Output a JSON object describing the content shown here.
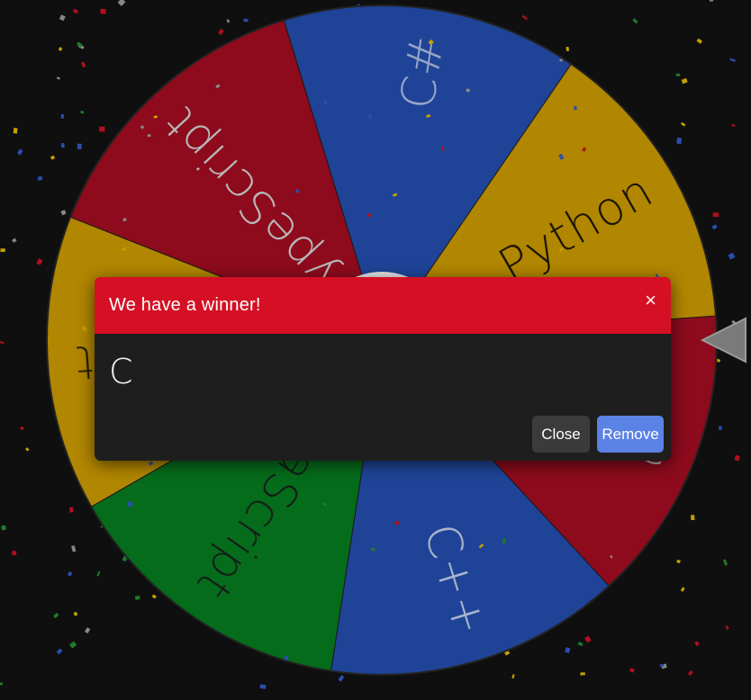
{
  "wheel": {
    "pointer_icon": "triangle-pointer-icon",
    "segments": [
      {
        "label": "C#",
        "color": "#1f4497",
        "text_color": "#9aa6c6"
      },
      {
        "label": "Python",
        "color": "#b18600",
        "text_color": "#1d1603"
      },
      {
        "label": "C",
        "color": "#8d0b1c",
        "text_color": "#b8b8b8"
      },
      {
        "label": "C++",
        "color": "#1f4497",
        "text_color": "#aab4cc"
      },
      {
        "label": "JavaScript",
        "color": "#056c1b",
        "text_color": "#142018"
      },
      {
        "label": "Rust",
        "color": "#b18600",
        "text_color": "#2a2208"
      },
      {
        "label": "TypeScript",
        "color": "#8d0b1c",
        "text_color": "#b8b8b8"
      }
    ]
  },
  "modal": {
    "title": "We have a winner!",
    "close_icon": "×",
    "winner": "C",
    "close_label": "Close",
    "remove_label": "Remove"
  },
  "colors": {
    "background": "#0f0f0f",
    "modal_header": "#d51024",
    "modal_body": "#1e1e1e",
    "remove_button": "#5b82e5",
    "close_button": "#3b3b3b"
  }
}
